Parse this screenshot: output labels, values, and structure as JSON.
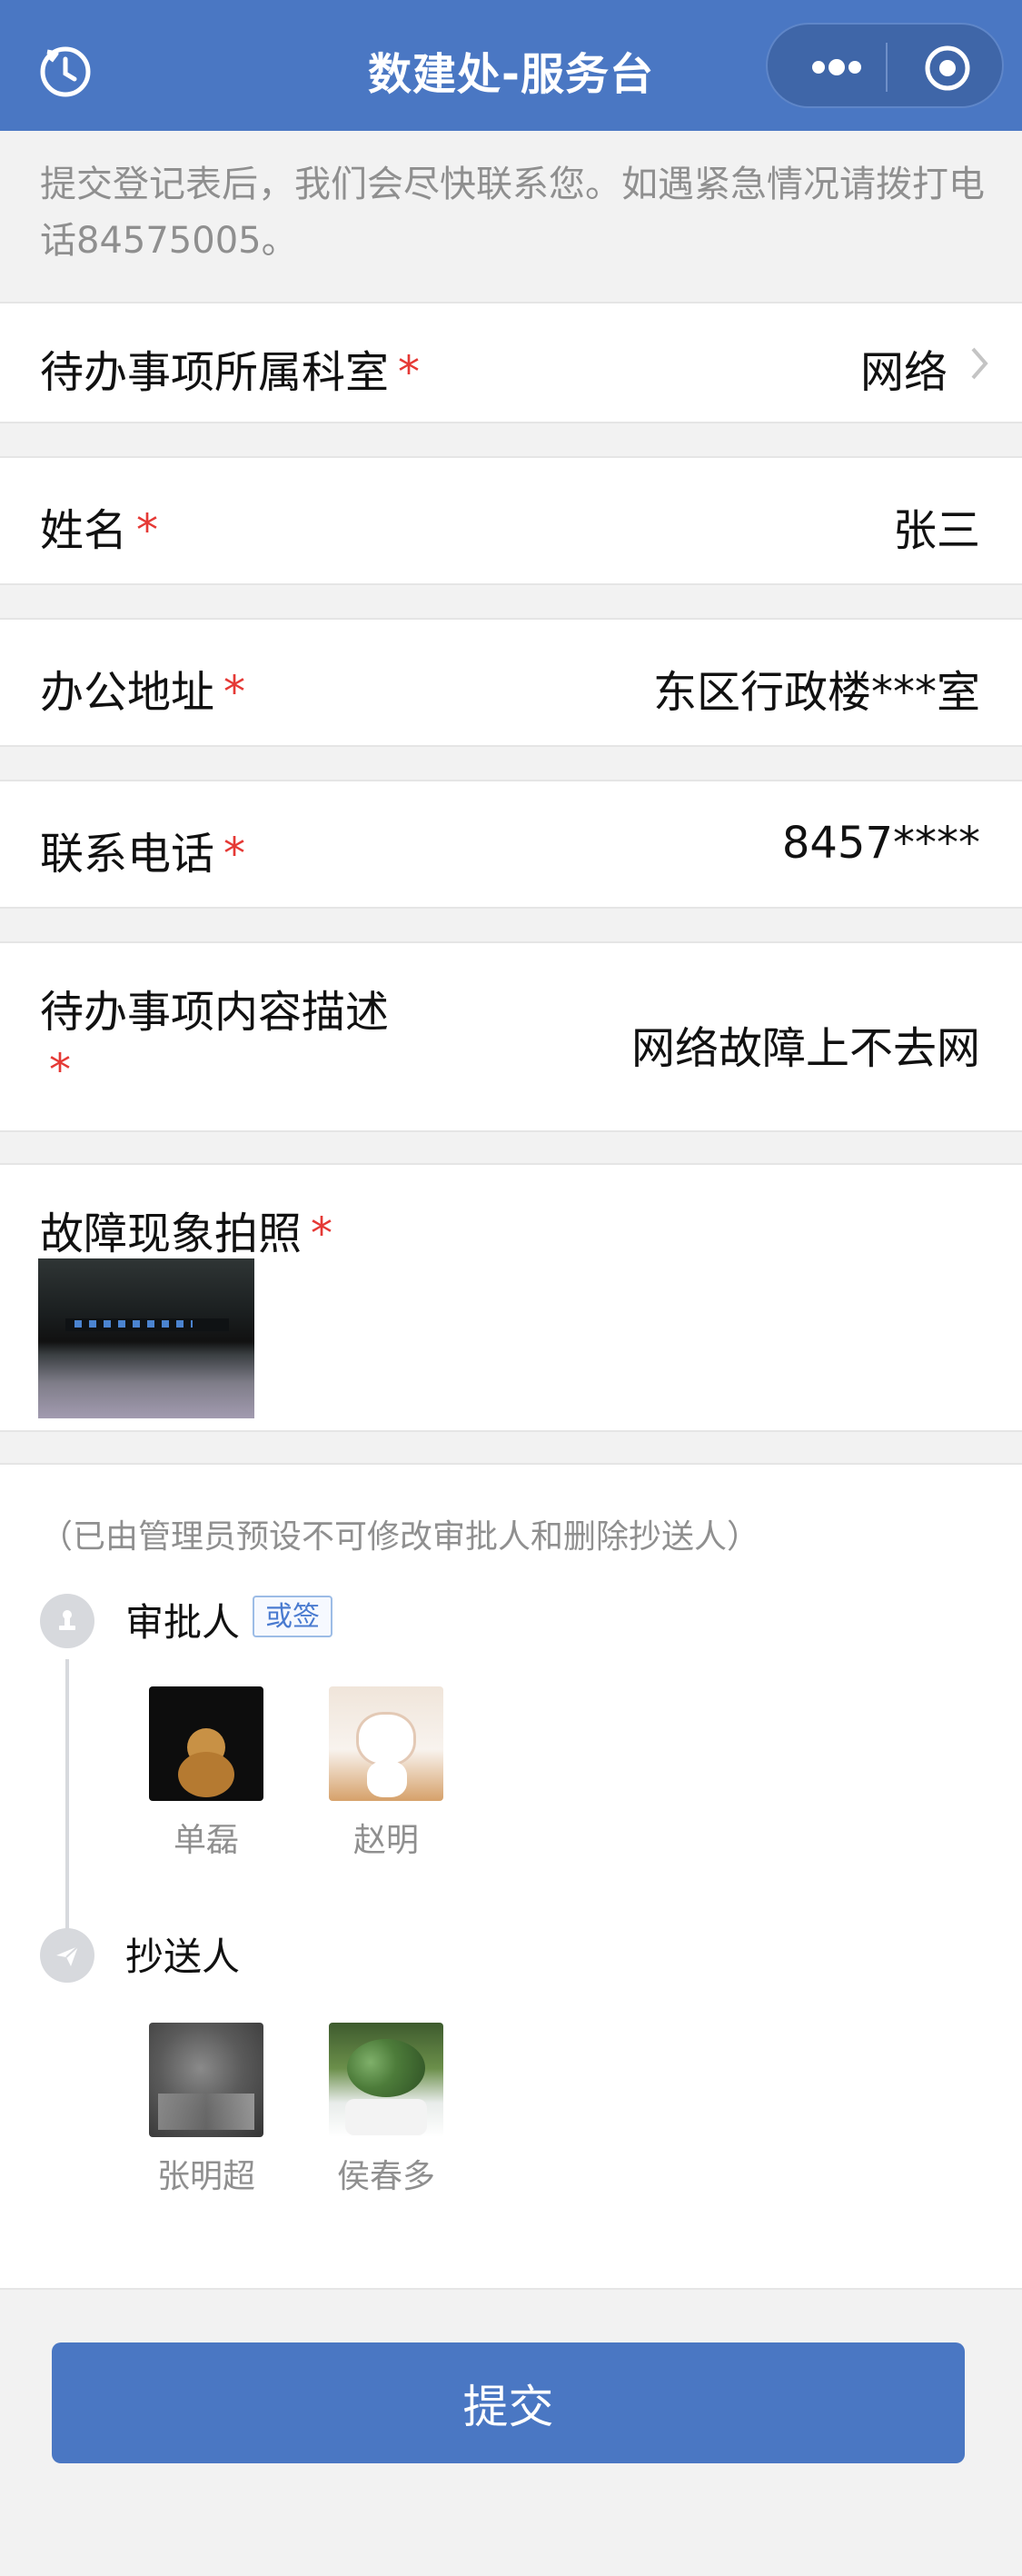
{
  "header": {
    "title": "数建处-服务台",
    "back_icon": "history-back-icon",
    "more_icon": "more-dots-icon",
    "close_icon": "target-icon",
    "color": "#4a77c3"
  },
  "notice": "提交登记表后，我们会尽快联系您。如遇紧急情况请拨打电话84575005。",
  "form": {
    "department_label": "待办事项所属科室",
    "department_value": "网络",
    "name_label": "姓名",
    "name_value": "张三",
    "address_label": "办公地址",
    "address_value": "东区行政楼***室",
    "phone_label": "联系电话",
    "phone_value": "8457****",
    "description_label": "待办事项内容描述",
    "description_value": "网络故障上不去网",
    "photo_label": "故障现象拍照",
    "required_mark": "*"
  },
  "approval": {
    "hint": "（已由管理员预设不可修改审批人和删除抄送人）",
    "approver_label": "审批人",
    "approver_badge": "或签",
    "approvers": [
      {
        "name": "单磊"
      },
      {
        "name": "赵明"
      }
    ],
    "cc_label": "抄送人",
    "cc": [
      {
        "name": "张明超"
      },
      {
        "name": "侯春多"
      }
    ]
  },
  "submit_label": "提交"
}
